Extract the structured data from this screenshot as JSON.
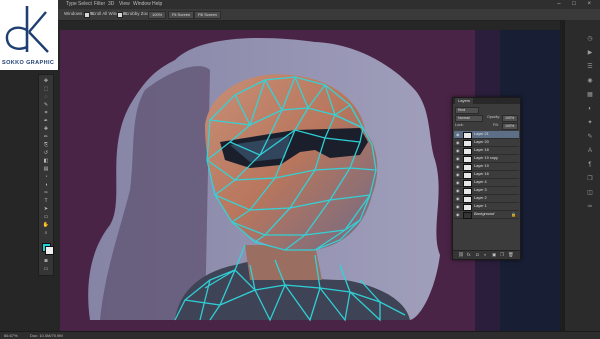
{
  "menu": {
    "items": [
      "Type",
      "Select",
      "Filter",
      "3D",
      "View",
      "Window",
      "Help"
    ],
    "window_controls": "– □ ×"
  },
  "options_bar": {
    "sample_label": "Windows & PS",
    "scroll_all_label": "Scroll All Windows",
    "scrubby_zoom_label": "Scrubby Zoom",
    "btn_100": "100%",
    "btn_fit": "Fit Screen",
    "btn_fill": "Fill Screen"
  },
  "logo": {
    "brand_text": "SOKKO GRAPHIC",
    "mark_color": "#1f3f73"
  },
  "tools": {
    "icons": [
      "move-icon",
      "marquee-icon",
      "lasso-icon",
      "quick-select-icon",
      "crop-icon",
      "eyedropper-icon",
      "healing-icon",
      "brush-icon",
      "clone-stamp-icon",
      "history-brush-icon",
      "eraser-icon",
      "gradient-icon",
      "blur-icon",
      "dodge-icon",
      "pen-icon",
      "type-icon",
      "path-select-icon",
      "shape-icon",
      "hand-icon",
      "zoom-icon"
    ],
    "glyphs": [
      "✥",
      "⬚",
      "◌",
      "✎",
      "⌗",
      "✒",
      "✚",
      "✏",
      "⎘",
      "↺",
      "◧",
      "▤",
      "◔",
      "◑",
      "✑",
      "T",
      "➤",
      "▭",
      "✋",
      "⌕"
    ],
    "foreground_color": "#1fd0d8",
    "background_color": "#f0f0f0"
  },
  "layers_panel": {
    "tab_label": "Layers",
    "kind_label": "Kind",
    "blend_mode": "Normal",
    "opacity_label": "Opacity:",
    "opacity_value": "100%",
    "lock_label": "Lock:",
    "fill_label": "Fill:",
    "fill_value": "100%",
    "layers": [
      {
        "name": "Layer 21",
        "selected": true
      },
      {
        "name": "Layer 20",
        "selected": false
      },
      {
        "name": "Layer 18",
        "selected": false
      },
      {
        "name": "Layer 19 copy",
        "selected": false
      },
      {
        "name": "Layer 19",
        "selected": false
      },
      {
        "name": "Layer 16",
        "selected": false
      },
      {
        "name": "Layer 4",
        "selected": false
      },
      {
        "name": "Layer 3",
        "selected": false
      },
      {
        "name": "Layer 2",
        "selected": false
      },
      {
        "name": "Layer 1",
        "selected": false
      },
      {
        "name": "Background",
        "selected": false,
        "background": true
      }
    ],
    "footer_icons": [
      "link-icon",
      "fx-icon",
      "mask-icon",
      "adjustment-icon",
      "group-icon",
      "new-layer-icon",
      "trash-icon"
    ],
    "footer_glyphs": [
      "⛓",
      "fx",
      "◘",
      "◐",
      "▣",
      "❐",
      "🗑"
    ]
  },
  "status_bar": {
    "zoom": "66.67%",
    "doc_info": "Doc: 10.0M/70.9M"
  },
  "colors": {
    "canvas_bg": "#4a2446",
    "mesh": "#2fd6dc",
    "selected_layer": "#5d6f86"
  }
}
